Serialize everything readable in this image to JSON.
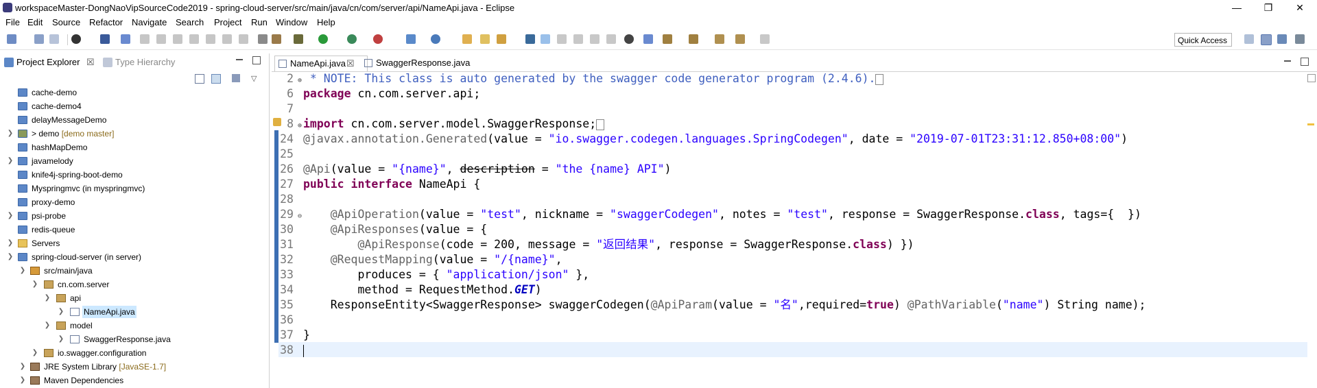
{
  "window": {
    "title": "workspaceMaster-DongNaoVipSourceCode2019 - spring-cloud-server/src/main/java/cn/com/server/api/NameApi.java - Eclipse",
    "minimize": "—",
    "maximize": "❐",
    "close": "✕"
  },
  "menu": [
    "File",
    "Edit",
    "Source",
    "Refactor",
    "Navigate",
    "Search",
    "Project",
    "Run",
    "Window",
    "Help"
  ],
  "toolbar": {
    "quick_access": "Quick Access"
  },
  "explorer": {
    "tab_label": "Project Explorer",
    "tab_close": "☒",
    "tab2_label": "Type Hierarchy",
    "tree": [
      {
        "label": "cache-demo",
        "deco": ""
      },
      {
        "label": "cache-demo4",
        "deco": ""
      },
      {
        "label": "delayMessageDemo",
        "deco": ""
      },
      {
        "label": "> demo",
        "deco": "[demo master]"
      },
      {
        "label": "hashMapDemo",
        "deco": ""
      },
      {
        "label": "javamelody",
        "deco": ""
      },
      {
        "label": "knife4j-spring-boot-demo",
        "deco": ""
      },
      {
        "label": "Myspringmvc (in myspringmvc)",
        "deco": ""
      },
      {
        "label": "proxy-demo",
        "deco": ""
      },
      {
        "label": "psi-probe",
        "deco": ""
      },
      {
        "label": "redis-queue",
        "deco": ""
      },
      {
        "label": "Servers",
        "deco": ""
      },
      {
        "label": "spring-cloud-server (in server)",
        "deco": ""
      },
      {
        "label": "src/main/java",
        "deco": ""
      },
      {
        "label": "cn.com.server",
        "deco": ""
      },
      {
        "label": "api",
        "deco": ""
      },
      {
        "label": "NameApi.java",
        "deco": ""
      },
      {
        "label": "model",
        "deco": ""
      },
      {
        "label": "SwaggerResponse.java",
        "deco": ""
      },
      {
        "label": "io.swagger.configuration",
        "deco": ""
      },
      {
        "label": "JRE System Library",
        "deco": "[JavaSE-1.7]"
      },
      {
        "label": "Maven Dependencies",
        "deco": ""
      }
    ]
  },
  "editor": {
    "tabs": [
      {
        "label": "NameApi.java",
        "close": "☒"
      },
      {
        "label": "SwaggerResponse.java"
      }
    ],
    "line_numbers": [
      "2",
      "6",
      "7",
      "8",
      "24",
      "25",
      "26",
      "27",
      "28",
      "29",
      "30",
      "31",
      "32",
      "33",
      "34",
      "35",
      "36",
      "37",
      "38"
    ],
    "code": {
      "l2": " * NOTE: This class is auto generated by the swagger code generator program (2.4.6).",
      "l6_kw": "package",
      "l6": " cn.com.server.api;",
      "l8_kw": "import",
      "l8": " cn.com.server.model.SwaggerResponse;",
      "l24_ann": "@javax.annotation.",
      "l24_gen": "Generated",
      "l24_a": "(value = ",
      "l24_s1": "\"io.swagger.codegen.languages.SpringCodegen\"",
      "l24_b": ", date = ",
      "l24_s2": "\"2019-07-01T23:31:12.850+08:00\"",
      "l24_c": ")",
      "l26_ann": "@Api",
      "l26_a": "(value = ",
      "l26_s1": "\"{name}\"",
      "l26_b": ", ",
      "l26_desc": "description",
      "l26_c": " = ",
      "l26_s2": "\"the {name} API\"",
      "l26_d": ")",
      "l27_kw1": "public",
      "l27_kw2": "interface",
      "l27": " NameApi {",
      "l29_ann": "@ApiOperation",
      "l29_a": "(value = ",
      "l29_s1": "\"test\"",
      "l29_b": ", nickname = ",
      "l29_s2": "\"swaggerCodegen\"",
      "l29_c": ", notes = ",
      "l29_s3": "\"test\"",
      "l29_d": ", response = SwaggerResponse.",
      "l29_kw": "class",
      "l29_e": ", tags={  })",
      "l30_ann": "@ApiResponses",
      "l30": "(value = {",
      "l31_ann": "@ApiResponse",
      "l31_a": "(code = 200, message = ",
      "l31_s": "\"返回结果\"",
      "l31_b": ", response = SwaggerResponse.",
      "l31_kw": "class",
      "l31_c": ") })",
      "l32_ann": "@RequestMapping",
      "l32_a": "(value = ",
      "l32_s": "\"/{name}\"",
      "l32_b": ",",
      "l33_a": "produces = { ",
      "l33_s": "\"application/json\"",
      "l33_b": " },",
      "l34_a": "method = RequestMethod.",
      "l34_st": "GET",
      "l34_b": ")",
      "l35_a": "ResponseEntity<SwaggerResponse> swaggerCodegen(",
      "l35_ann1": "@ApiParam",
      "l35_b": "(value = ",
      "l35_s1": "\"名\"",
      "l35_c": ",required=",
      "l35_kw": "true",
      "l35_d": ") ",
      "l35_ann2": "@PathVariable",
      "l35_e": "(",
      "l35_s2": "\"name\"",
      "l35_f": ") String name);",
      "l37": "}"
    }
  }
}
